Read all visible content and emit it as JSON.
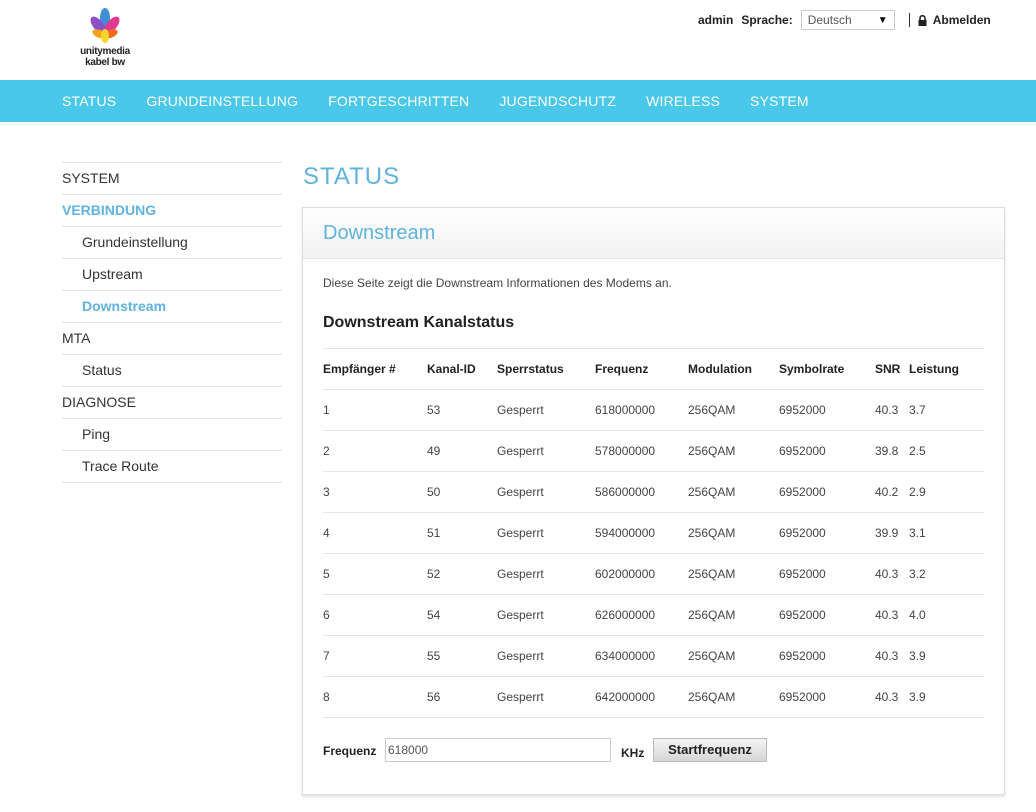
{
  "brand": {
    "line1": "unitymedia",
    "line2": "kabel bw"
  },
  "topbar": {
    "user": "admin",
    "language_label": "Sprache:",
    "language_value": "Deutsch",
    "logout_label": "Abmelden"
  },
  "nav": [
    "STATUS",
    "GRUNDEINSTELLUNG",
    "FORTGESCHRITTEN",
    "JUGENDSCHUTZ",
    "WIRELESS",
    "SYSTEM"
  ],
  "sidebar": [
    {
      "label": "SYSTEM",
      "sub": false,
      "active": false
    },
    {
      "label": "VERBINDUNG",
      "sub": false,
      "active": true
    },
    {
      "label": "Grundeinstellung",
      "sub": true,
      "active": false
    },
    {
      "label": "Upstream",
      "sub": true,
      "active": false
    },
    {
      "label": "Downstream",
      "sub": true,
      "active": true
    },
    {
      "label": "MTA",
      "sub": false,
      "active": false
    },
    {
      "label": "Status",
      "sub": true,
      "active": false
    },
    {
      "label": "DIAGNOSE",
      "sub": false,
      "active": false
    },
    {
      "label": "Ping",
      "sub": true,
      "active": false
    },
    {
      "label": "Trace Route",
      "sub": true,
      "active": false
    }
  ],
  "page_title": "STATUS",
  "panel": {
    "title": "Downstream",
    "description": "Diese Seite zeigt die Downstream Informationen des Modems an.",
    "section_title": "Downstream Kanalstatus"
  },
  "table": {
    "headers": [
      "Empfänger #",
      "Kanal-ID",
      "Sperrstatus",
      "Frequenz",
      "Modulation",
      "Symbolrate",
      "SNR",
      "Leistung"
    ],
    "rows": [
      [
        "1",
        "53",
        "Gesperrt",
        "618000000",
        "256QAM",
        "6952000",
        "40.3",
        "3.7"
      ],
      [
        "2",
        "49",
        "Gesperrt",
        "578000000",
        "256QAM",
        "6952000",
        "39.8",
        "2.5"
      ],
      [
        "3",
        "50",
        "Gesperrt",
        "586000000",
        "256QAM",
        "6952000",
        "40.2",
        "2.9"
      ],
      [
        "4",
        "51",
        "Gesperrt",
        "594000000",
        "256QAM",
        "6952000",
        "39.9",
        "3.1"
      ],
      [
        "5",
        "52",
        "Gesperrt",
        "602000000",
        "256QAM",
        "6952000",
        "40.3",
        "3.2"
      ],
      [
        "6",
        "54",
        "Gesperrt",
        "626000000",
        "256QAM",
        "6952000",
        "40.3",
        "4.0"
      ],
      [
        "7",
        "55",
        "Gesperrt",
        "634000000",
        "256QAM",
        "6952000",
        "40.3",
        "3.9"
      ],
      [
        "8",
        "56",
        "Gesperrt",
        "642000000",
        "256QAM",
        "6952000",
        "40.3",
        "3.9"
      ]
    ]
  },
  "frequency_form": {
    "label": "Frequenz",
    "value": "618000",
    "unit": "KHz",
    "button": "Startfrequenz"
  },
  "colors": {
    "nav": "#49c8ea",
    "accent": "#5fb3dc"
  }
}
